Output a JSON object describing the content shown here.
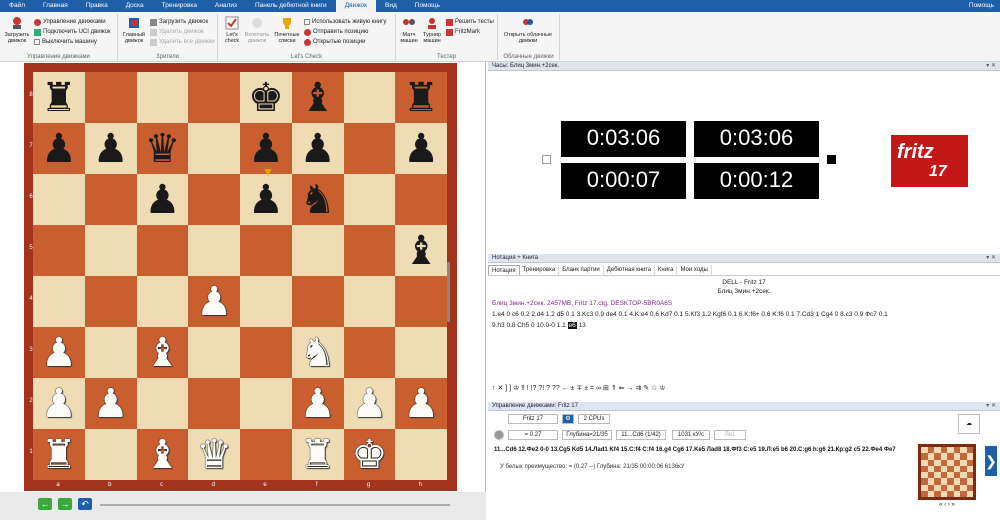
{
  "menu": {
    "items": [
      "Файл",
      "Главная",
      "Правка",
      "Доска",
      "Тренировка",
      "Анализ",
      "Панель дебютной книги",
      "Движок",
      "Вид",
      "Помощь"
    ],
    "active_index": 7,
    "help": "Помощь"
  },
  "ribbon": {
    "engine_group": {
      "load": "Загрузить движок",
      "manage": "Управление движками",
      "uci": "Подключить UCI движок",
      "off": "Выключить машину",
      "label": "Управление движками"
    },
    "viewers_group": {
      "main": "Главный движок",
      "load": "Загрузить движок",
      "remove": "Удалить движок",
      "remove_all": "Удалить все движки",
      "label": "Зрители"
    },
    "letscheck_group": {
      "letscheck": "Let's check",
      "enable": "Включить движок",
      "honor": "Почетные списки",
      "use_book": "Использовать живую книгу",
      "send": "Отправить позицию",
      "open": "Открытые позиции",
      "label": "Let's Check"
    },
    "tester_group": {
      "match": "Матч машин",
      "tourn": "Турнир машин",
      "solve": "Решить тесты",
      "fritzmark": "FritzMark",
      "label": "Тестер"
    },
    "cloud_group": {
      "open": "Открыть облачные движки",
      "label": "Облачные движки"
    }
  },
  "board": {
    "files": [
      "a",
      "b",
      "c",
      "d",
      "e",
      "f",
      "g",
      "h"
    ],
    "ranks": [
      "8",
      "7",
      "6",
      "5",
      "4",
      "3",
      "2",
      "1"
    ],
    "position": [
      [
        "r",
        "",
        "",
        "",
        "k",
        "b",
        "",
        "r"
      ],
      [
        "p",
        "p",
        "q",
        "",
        "p",
        "p",
        "",
        "p"
      ],
      [
        "",
        "",
        "p",
        "",
        "p",
        "n",
        "",
        ""
      ],
      [
        "",
        "",
        "",
        "",
        "",
        "",
        "",
        "b"
      ],
      [
        "",
        "",
        "",
        "P",
        "",
        "",
        "",
        ""
      ],
      [
        "P",
        "",
        "B",
        "",
        "",
        "N",
        "",
        ""
      ],
      [
        "P",
        "P",
        "",
        "",
        "",
        "P",
        "P",
        "P"
      ],
      [
        "R",
        "",
        "B",
        "Q",
        "",
        "R",
        "K",
        ""
      ]
    ],
    "nav_back": "←",
    "nav_forward": "→",
    "nav_undo": "↶"
  },
  "clock": {
    "title": "Часы: Блиц 3мин.+2сек.",
    "pin": "▾ ✕",
    "white_main": "0:03:06",
    "black_main": "0:03:06",
    "white_move": "0:00:07",
    "black_move": "0:00:12",
    "logo_text": "fritz",
    "logo_num": "17"
  },
  "notation": {
    "title": "Нотация + Книга",
    "tabs": [
      "Нотация",
      "Тренировка",
      "Бланк партии",
      "Дебютная книга",
      "Книга",
      "Мои ходы"
    ],
    "players": "DELL - Fritz 17",
    "event": "Блиц 3мин.+2сек.",
    "gameinfo": "Блиц 3мин.+2сек. 2457MB, Fritz 17.ctg, DESKTOP-5BR0A6S",
    "moves_line1": "1.e4 0  c6 0.2  2.d4 1.2  d5 0.1  3.Kc3 0.9  de4 0.1  4.K:e4 0.6  Kd7 0.1  5.Kf3 1.2  Kgf6 0.1  6.K:f6+ 0.6  K:f6 0.1  7.Cd3 1  Cg4 0  8.c3 0.9  Фc7 0.1",
    "moves_line2_pre": "9.h3 0.8  Ch5 0  10.0-0 1.1  ",
    "moves_current": "e6",
    "moves_line2_post": " 13",
    "symbols": "↑ ✕ ] ] ♔ ‼ ! !? ?! ? ?? ← ± ∓ ± = ∞ ⊞ ⇑ ⇐ → ⇉ ✎ ☆ ♔"
  },
  "engine": {
    "title": "Управление движками: Fritz 17",
    "name": "Fritz 17",
    "cpus": "2 CPUs",
    "eval": "= 0.27",
    "depth": "Глубина=21/35",
    "move": "11...Cd6 (1/42)",
    "speed": "1031 кУ/с",
    "last": "Ле1",
    "line": "11...Cd6 12.Фe2 0-0 13.Cg5 Kd5 14.Лad1 Kf4 15.C:f4 C:f4 16.g4 Cg6 17.Ke5 Лad8 18.Фf3 C:e5 19.Л:e5 b6 20.C:g6 h:g6 21.Кр:g2 c5 22.Фe4 Фe7",
    "summary": "У белых преимущество: = (0.27 --)  Глубина: 21/35   00:00:06  6136кУ",
    "mininav": "« ‹ › »"
  }
}
